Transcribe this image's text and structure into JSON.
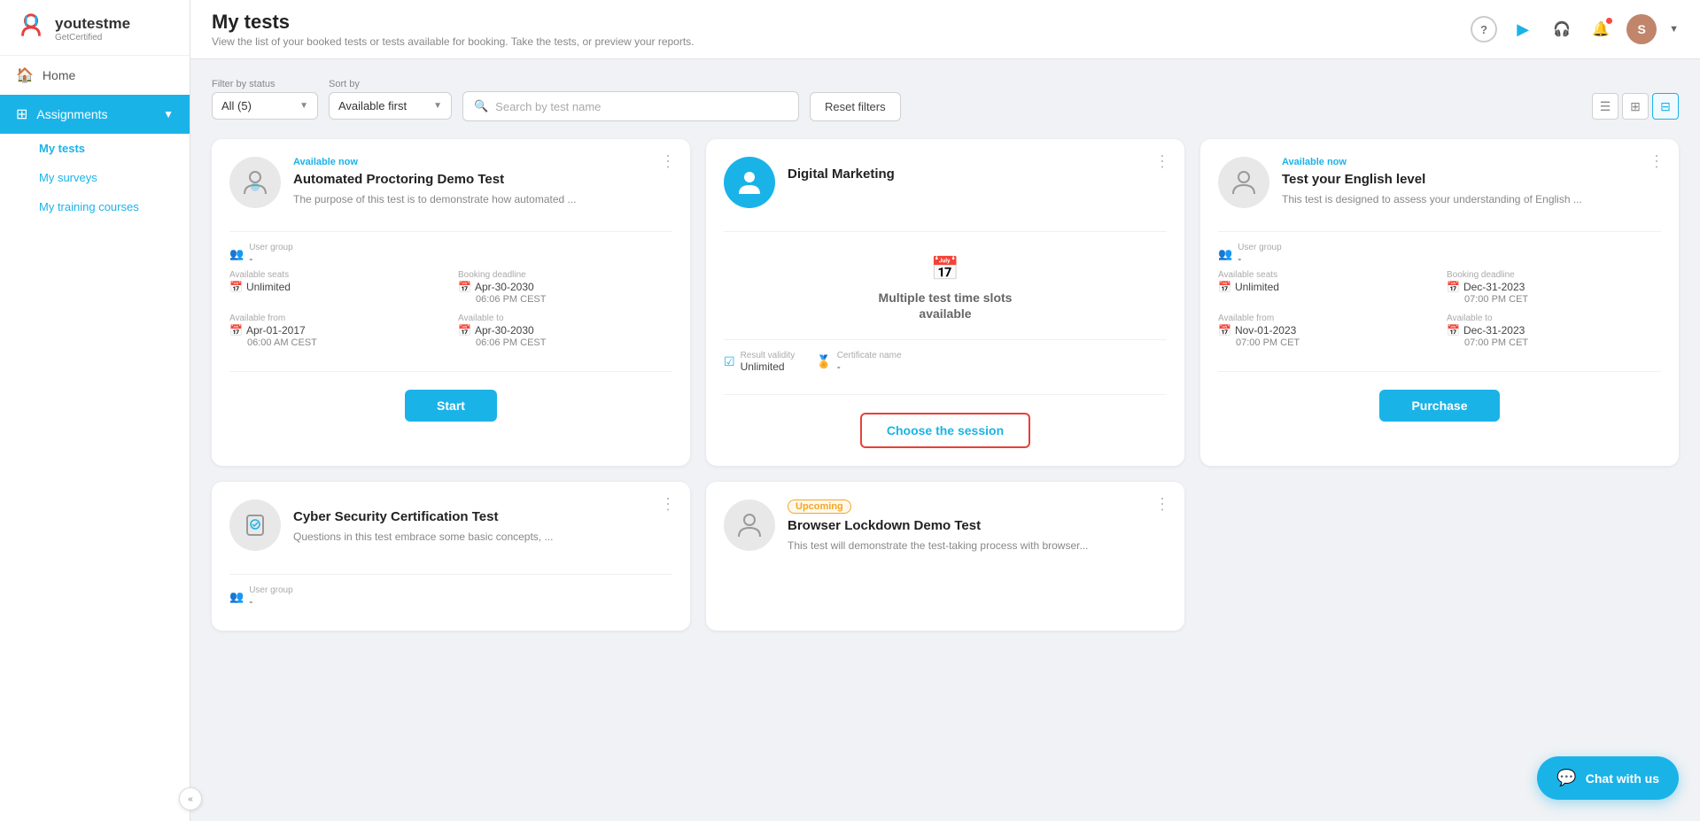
{
  "brand": {
    "name": "youtestme",
    "tagline": "GetCertified"
  },
  "sidebar": {
    "home_label": "Home",
    "assignments_label": "Assignments",
    "my_tests_label": "My tests",
    "my_surveys_label": "My surveys",
    "my_training_label": "My training courses",
    "collapse_icon": "«"
  },
  "topbar": {
    "title": "My tests",
    "subtitle": "View the list of your booked tests or tests available for booking. Take the tests, or preview your reports.",
    "help_icon": "?",
    "play_icon": "▶"
  },
  "filters": {
    "status_label": "Filter by status",
    "status_value": "All (5)",
    "sort_label": "Sort by",
    "sort_value": "Available first",
    "search_placeholder": "Search by test name",
    "reset_label": "Reset filters"
  },
  "cards": [
    {
      "id": "card1",
      "badge": "Available now",
      "badge_type": "available",
      "title": "Automated Proctoring Demo Test",
      "description": "The purpose of this test is to demonstrate how automated ...",
      "avatar_type": "grey",
      "user_group_label": "User group",
      "user_group_value": "-",
      "seats_label": "Available seats",
      "seats_value": "Unlimited",
      "booking_deadline_label": "Booking deadline",
      "booking_deadline_value": "Apr-30-2030",
      "booking_deadline_time": "06:06 PM CEST",
      "available_from_label": "Available from",
      "available_from_value": "Apr-01-2017",
      "available_from_time": "06:00 AM CEST",
      "available_to_label": "Available to",
      "available_to_value": "Apr-30-2030",
      "available_to_time": "06:06 PM CEST",
      "action_label": "Start",
      "action_type": "primary"
    },
    {
      "id": "card2",
      "badge": "",
      "badge_type": "none",
      "title": "Digital Marketing",
      "description": "",
      "avatar_type": "blue",
      "center_icon": "📅",
      "center_text": "Multiple test time slots available",
      "result_validity_label": "Result validity",
      "result_validity_value": "Unlimited",
      "certificate_label": "Certificate name",
      "certificate_value": "-",
      "action_label": "Choose the session",
      "action_type": "outlined"
    },
    {
      "id": "card3",
      "badge": "Available now",
      "badge_type": "available",
      "title": "Test your English level",
      "description": "This test is designed to assess your understanding of English ...",
      "avatar_type": "grey",
      "user_group_label": "User group",
      "user_group_value": "-",
      "seats_label": "Available seats",
      "seats_value": "Unlimited",
      "booking_deadline_label": "Booking deadline",
      "booking_deadline_value": "Dec-31-2023",
      "booking_deadline_time": "07:00 PM CET",
      "available_from_label": "Available from",
      "available_from_value": "Nov-01-2023",
      "available_from_time": "07:00 PM CET",
      "available_to_label": "Available to",
      "available_to_value": "Dec-31-2023",
      "available_to_time": "07:00 PM CET",
      "action_label": "Purchase",
      "action_type": "primary"
    },
    {
      "id": "card4",
      "badge": "",
      "badge_type": "none",
      "title": "Cyber Security Certification Test",
      "description": "Questions in this test embrace some basic concepts, ...",
      "avatar_type": "grey-shield",
      "user_group_label": "User group",
      "user_group_value": "-",
      "action_label": "",
      "action_type": "none"
    },
    {
      "id": "card5",
      "badge": "Upcoming",
      "badge_type": "upcoming",
      "title": "Browser Lockdown Demo Test",
      "description": "This test will demonstrate the test-taking process with browser...",
      "avatar_type": "grey",
      "action_label": "",
      "action_type": "none"
    }
  ],
  "chat": {
    "label": "Chat with us"
  }
}
